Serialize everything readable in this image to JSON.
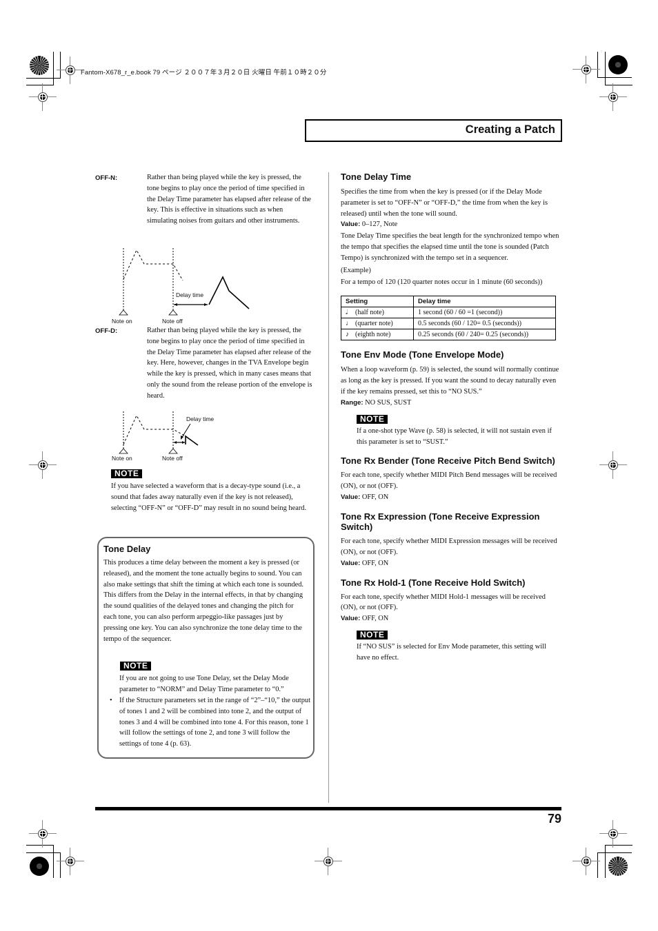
{
  "print_header": {
    "book_line": "Fantom-X678_r_e.book  79 ページ  ２００７年３月２０日  火曜日  午前１０時２０分"
  },
  "section_title": "Creating a Patch",
  "left_column": {
    "off_n": {
      "label": "OFF-N:",
      "text": "Rather than being played while the key is pressed, the tone begins to play once the period of time specified in the Delay Time parameter has elapsed after release of the key. This is effective in situations such as when simulating noises from guitars and other instruments."
    },
    "diagram1": {
      "delay_label": "Delay time",
      "note_on": "Note on",
      "note_off": "Note off"
    },
    "off_d": {
      "label": "OFF-D:",
      "text": "Rather than being played while the key is pressed, the tone begins to play once the period of time specified in the Delay Time parameter has elapsed after release of the key. Here, however, changes in the TVA Envelope begin while the key is pressed, which in many cases means that only the sound from the release portion of the envelope is heard."
    },
    "diagram2": {
      "delay_label": "Delay time",
      "note_on": "Note on",
      "note_off": "Note off"
    },
    "note1": {
      "badge": "NOTE",
      "text": "If you have selected a waveform that is a decay-type sound (i.e., a sound that fades away naturally even if the key is not released), selecting “OFF-N” or “OFF-D” may result in no sound being heard."
    },
    "tone_delay_box": {
      "title": "Tone Delay",
      "text": "This produces a time delay between the moment a key is pressed (or released), and the moment the tone actually begins to sound. You can also make settings that shift the timing at which each tone is sounded. This differs from the Delay in the internal effects, in that by changing the sound qualities of the delayed tones and changing the pitch for each tone, you can also perform arpeggio-like passages just by pressing one key. You can also synchronize the tone delay time to the tempo of the sequencer.",
      "note_badge": "NOTE",
      "note_text": "If you are not going to use Tone Delay, set the Delay Mode parameter to “NORM” and Delay Time parameter to “0.”",
      "bullet": "•",
      "bullet_text": "If the Structure parameters set in the range of “2”–“10,” the output of tones 1 and 2 will be combined into tone 2, and the output of tones 3 and 4 will be combined into tone 4. For this reason, tone 1 will follow the settings of tone 2, and tone 3 will follow the settings of tone 4 (p. 63)."
    }
  },
  "right_column": {
    "tone_delay_time": {
      "title": "Tone Delay Time",
      "text1": "Specifies the time from when the key is pressed (or if the Delay Mode parameter is set to “OFF-N” or “OFF-D,” the time from when the key is released) until when the tone will sound.",
      "value_label": "Value:",
      "value": " 0–127, Note",
      "text2": "Tone Delay Time specifies the beat length for the synchronized tempo when the tempo that specifies the elapsed time until the tone is sounded (Patch Tempo) is synchronized with the tempo set in a sequencer.",
      "example_label": "(Example)",
      "example_text": "For a tempo of 120 (120 quarter notes occur in 1 minute (60 seconds))",
      "table": {
        "headers": [
          "Setting",
          "Delay time"
        ],
        "rows": [
          {
            "icon": "𝅗𝅥",
            "setting": "(half note)",
            "delay": "1 second (60 / 60 =1 (second))"
          },
          {
            "icon": "♩",
            "setting": "(quarter note)",
            "delay": "0.5 seconds (60 / 120= 0.5 (seconds))"
          },
          {
            "icon": "♪",
            "setting": "(eighth note)",
            "delay": "0.25 seconds (60 / 240= 0.25 (seconds))"
          }
        ]
      }
    },
    "tone_env_mode": {
      "title": "Tone Env Mode (Tone Envelope Mode)",
      "text": "When a loop waveform (p. 59) is selected, the sound will normally continue as long as the key is pressed. If you want the sound to decay naturally even if the key remains pressed, set this to “NO SUS.”",
      "range_label": "Range:",
      "range": " NO SUS, SUST",
      "note_badge": "NOTE",
      "note_text": "If a one-shot type Wave (p. 58) is selected, it will not sustain even if this parameter is set to “SUST.”"
    },
    "tone_rx_bender": {
      "title": "Tone Rx Bender (Tone Receive Pitch Bend Switch)",
      "text": "For each tone, specify whether MIDI Pitch Bend messages will be received (ON), or not (OFF).",
      "value_label": "Value:",
      "value": " OFF, ON"
    },
    "tone_rx_expression": {
      "title": "Tone Rx Expression (Tone Receive Expression Switch)",
      "text": "For each tone, specify whether MIDI Expression messages will be received (ON), or not (OFF).",
      "value_label": "Value:",
      "value": " OFF, ON"
    },
    "tone_rx_hold": {
      "title": "Tone Rx Hold-1 (Tone Receive Hold Switch)",
      "text": "For each tone, specify whether MIDI Hold-1 messages will be received (ON), or not (OFF).",
      "value_label": "Value:",
      "value": " OFF, ON",
      "note_badge": "NOTE",
      "note_text": "If “NO SUS” is selected for Env Mode parameter, this setting will have no effect."
    }
  },
  "footer": {
    "page_number": "79"
  }
}
